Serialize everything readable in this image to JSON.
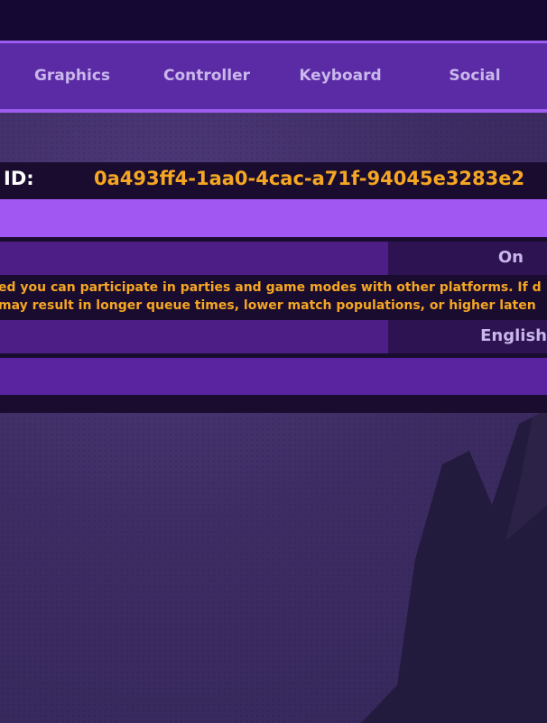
{
  "tabs": [
    {
      "label": "Graphics"
    },
    {
      "label": "Controller"
    },
    {
      "label": "Keyboard"
    },
    {
      "label": "Social"
    }
  ],
  "account": {
    "id_label": "ID:",
    "id_value": "0a493ff4-1aa0-4cac-a71f-94045e3283e2"
  },
  "crossplay": {
    "value": "On",
    "description_line1": "ed you can participate in parties and game modes with other platforms. If d",
    "description_line2": "may result in longer queue times, lower match populations, or higher laten"
  },
  "language": {
    "value": "English"
  },
  "colors": {
    "accent": "#a157f2",
    "highlight_text": "#f5a623",
    "tab_bar": "#5b2ba6"
  }
}
